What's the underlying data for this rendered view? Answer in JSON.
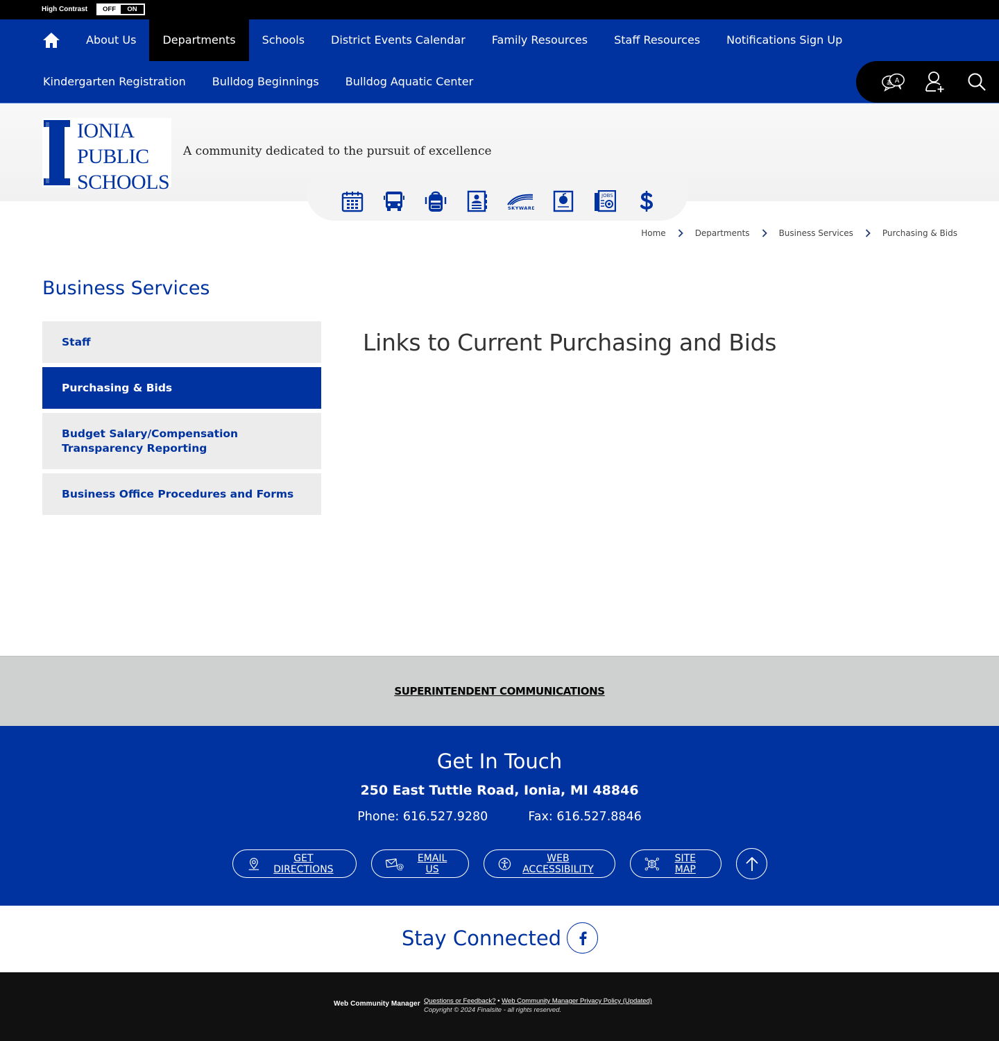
{
  "high_contrast": {
    "label": "High Contrast",
    "off_label": "OFF",
    "on_label": "ON",
    "state": "OFF"
  },
  "nav": {
    "home_icon": "home-icon",
    "row1": [
      {
        "label": "About Us",
        "active": false
      },
      {
        "label": "Departments",
        "active": true
      },
      {
        "label": "Schools",
        "active": false
      },
      {
        "label": "District Events Calendar",
        "active": false
      },
      {
        "label": "Family Resources",
        "active": false
      },
      {
        "label": "Staff Resources",
        "active": false
      },
      {
        "label": "Notifications Sign Up",
        "active": false
      }
    ],
    "row2": [
      {
        "label": "Kindergarten Registration"
      },
      {
        "label": "Bulldog Beginnings"
      },
      {
        "label": "Bulldog Aquatic Center"
      }
    ],
    "tools": [
      "translate-icon",
      "user-add-icon",
      "search-icon"
    ]
  },
  "header": {
    "logo_lines": [
      "IONIA",
      "PUBLIC",
      "SCHOOLS"
    ],
    "tagline": "A community dedicated to the pursuit of excellence",
    "brand_color": "#0033a0"
  },
  "quick_links": [
    {
      "icon": "calendar-icon"
    },
    {
      "icon": "bus-icon"
    },
    {
      "icon": "backpack-icon"
    },
    {
      "icon": "directory-icon"
    },
    {
      "icon": "skyward-logo",
      "text": "SKYWARD"
    },
    {
      "icon": "apple-report-icon"
    },
    {
      "icon": "jobs-icon",
      "text": "JOBS"
    },
    {
      "icon": "dollar-icon"
    }
  ],
  "breadcrumb": [
    "Home",
    "Departments",
    "Business Services",
    "Purchasing & Bids"
  ],
  "sidebar": {
    "title": "Business Services",
    "items": [
      {
        "label": "Staff",
        "active": false
      },
      {
        "label": "Purchasing & Bids",
        "active": true
      },
      {
        "label": "Budget Salary/Compensation Transparency Reporting",
        "active": false
      },
      {
        "label": "Business Office Procedures and Forms",
        "active": false
      }
    ]
  },
  "main": {
    "heading": "Links to Current Purchasing and Bids"
  },
  "superintendent": {
    "link": "SUPERINTENDENT COMMUNICATIONS"
  },
  "contact": {
    "title": "Get In Touch",
    "address": "250 East Tuttle Road, Ionia, MI 48846",
    "phone": "Phone: 616.527.9280",
    "fax": "Fax: 616.527.8846",
    "buttons": [
      {
        "label": "GET DIRECTIONS",
        "icon": "map-pin-icon"
      },
      {
        "label": "EMAIL US",
        "icon": "email-icon"
      },
      {
        "label": "WEB ACCESSIBILITY",
        "icon": "accessibility-icon"
      },
      {
        "label": "SITE MAP",
        "icon": "sitemap-icon"
      }
    ],
    "back_to_top_icon": "arrow-up-icon"
  },
  "social": {
    "title": "Stay Connected",
    "networks": [
      {
        "name": "Facebook",
        "icon": "facebook-icon"
      }
    ]
  },
  "footer": {
    "brand": "Web Community Manager",
    "links": [
      "Questions or Feedback?",
      "Web Community Manager Privacy Policy (Updated)"
    ],
    "separator": "•",
    "copyright": "Copyright © 2024 Finalsite - all rights reserved."
  }
}
